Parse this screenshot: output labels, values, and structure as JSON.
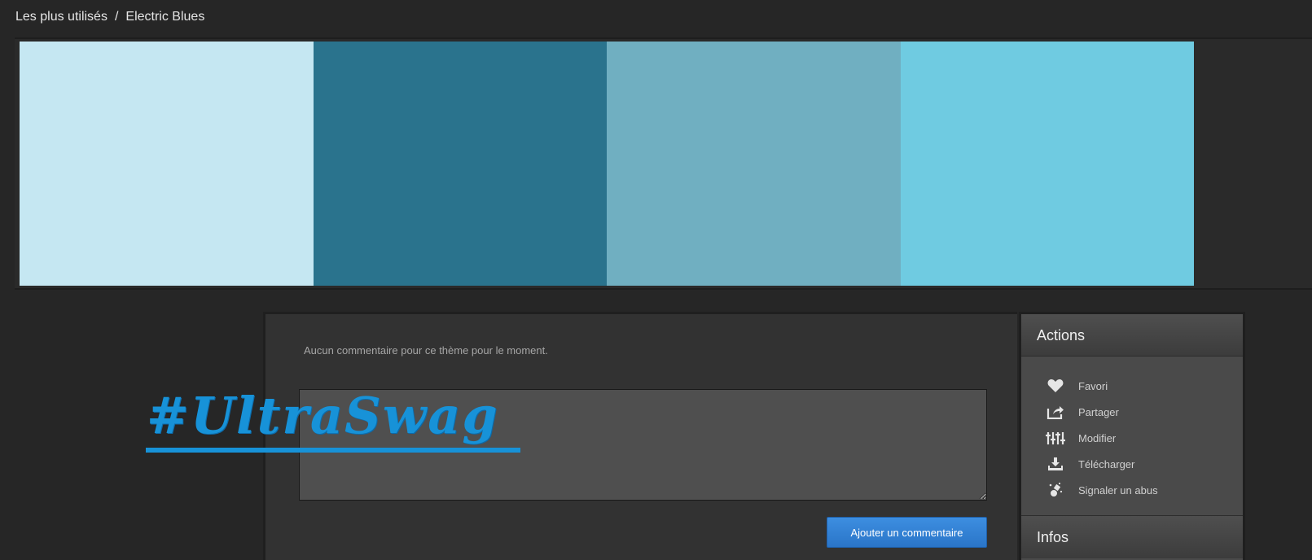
{
  "breadcrumb": {
    "parent": "Les plus utilisés",
    "separator": "/",
    "current": "Electric Blues"
  },
  "palette": {
    "swatches": [
      {
        "color": "#C5E7F2"
      },
      {
        "color": "#2A738D"
      },
      {
        "color": "#70AFC1"
      },
      {
        "color": "#6FCBE1"
      }
    ]
  },
  "comments": {
    "empty_message": "Aucun commentaire pour ce thème pour le moment.",
    "input_value": "",
    "submit_label": "Ajouter un commentaire"
  },
  "actions": {
    "title": "Actions",
    "items": [
      {
        "label": "Favori",
        "icon": "heart-icon"
      },
      {
        "label": "Partager",
        "icon": "share-icon"
      },
      {
        "label": "Modifier",
        "icon": "sliders-icon"
      },
      {
        "label": "Télécharger",
        "icon": "download-icon"
      },
      {
        "label": "Signaler un abus",
        "icon": "flag-abuse-icon"
      }
    ]
  },
  "infos": {
    "title": "Infos"
  },
  "watermark": {
    "text": "#UltraSwag"
  },
  "colors": {
    "accent_button": "#2F7FD6",
    "watermark": "#1792D8"
  }
}
